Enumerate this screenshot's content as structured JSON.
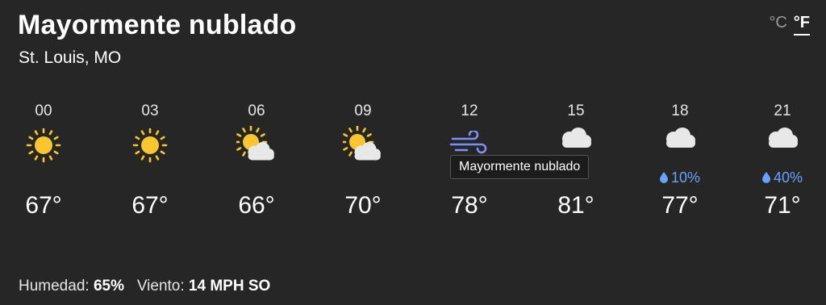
{
  "header": {
    "title": "Mayormente nublado",
    "location": "St. Louis, MO"
  },
  "units": {
    "celsius": "°C",
    "fahrenheit": "°F",
    "selected": "°F"
  },
  "hours": [
    {
      "time": "00",
      "icon": "sun-icon",
      "temp": "67°",
      "precip": ""
    },
    {
      "time": "03",
      "icon": "sun-icon",
      "temp": "67°",
      "precip": ""
    },
    {
      "time": "06",
      "icon": "partly-cloudy-icon",
      "temp": "66°",
      "precip": ""
    },
    {
      "time": "09",
      "icon": "partly-cloudy-icon",
      "temp": "70°",
      "precip": ""
    },
    {
      "time": "12",
      "icon": "wind-icon",
      "temp": "78°",
      "precip": ""
    },
    {
      "time": "15",
      "icon": "cloud-icon",
      "temp": "81°",
      "precip": ""
    },
    {
      "time": "18",
      "icon": "cloud-icon",
      "temp": "77°",
      "precip": "10%"
    },
    {
      "time": "21",
      "icon": "cloud-icon",
      "temp": "71°",
      "precip": "40%"
    }
  ],
  "tooltip": {
    "text": "Mayormente nublado"
  },
  "details": {
    "humidity_label": "Humedad:",
    "humidity_value": "65%",
    "wind_label": "Viento:",
    "wind_value": "14 MPH SO"
  },
  "colors": {
    "sun": "#f8c533",
    "cloud": "#e8e8e8",
    "wind": "#7d8ff2",
    "rain": "#6aa1ff",
    "background": "#262626"
  }
}
